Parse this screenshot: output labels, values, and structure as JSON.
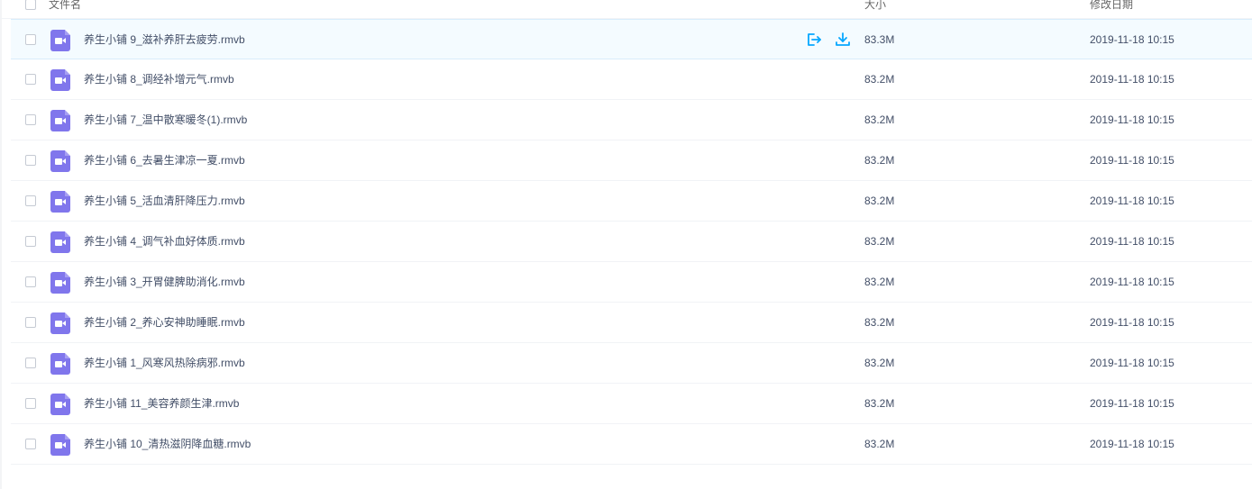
{
  "header": {
    "name_col": "文件名",
    "size_col": "大小",
    "date_col": "修改日期"
  },
  "files": [
    {
      "name": "养生小铺 9_滋补养肝去疲劳.rmvb",
      "size": "83.3M",
      "date": "2019-11-18 10:15"
    },
    {
      "name": "养生小铺 8_调经补增元气.rmvb",
      "size": "83.2M",
      "date": "2019-11-18 10:15"
    },
    {
      "name": "养生小铺 7_温中散寒暖冬(1).rmvb",
      "size": "83.2M",
      "date": "2019-11-18 10:15"
    },
    {
      "name": "养生小铺 6_去暑生津凉一夏.rmvb",
      "size": "83.2M",
      "date": "2019-11-18 10:15"
    },
    {
      "name": "养生小铺 5_活血清肝降压力.rmvb",
      "size": "83.2M",
      "date": "2019-11-18 10:15"
    },
    {
      "name": "养生小铺 4_调气补血好体质.rmvb",
      "size": "83.2M",
      "date": "2019-11-18 10:15"
    },
    {
      "name": "养生小铺 3_开胃健脾助消化.rmvb",
      "size": "83.2M",
      "date": "2019-11-18 10:15"
    },
    {
      "name": "养生小铺 2_养心安神助睡眠.rmvb",
      "size": "83.2M",
      "date": "2019-11-18 10:15"
    },
    {
      "name": "养生小铺 1_风寒风热除病邪.rmvb",
      "size": "83.2M",
      "date": "2019-11-18 10:15"
    },
    {
      "name": "养生小铺 11_美容养颜生津.rmvb",
      "size": "83.2M",
      "date": "2019-11-18 10:15"
    },
    {
      "name": "养生小铺 10_清热滋阴降血糖.rmvb",
      "size": "83.2M",
      "date": "2019-11-18 10:15"
    }
  ],
  "icons": {
    "file": "video-file-icon",
    "share": "share-icon",
    "download": "download-icon"
  },
  "colors": {
    "accent": "#06a7ff",
    "file_icon": "#8076ec",
    "hover_row": "#f4fbff"
  }
}
